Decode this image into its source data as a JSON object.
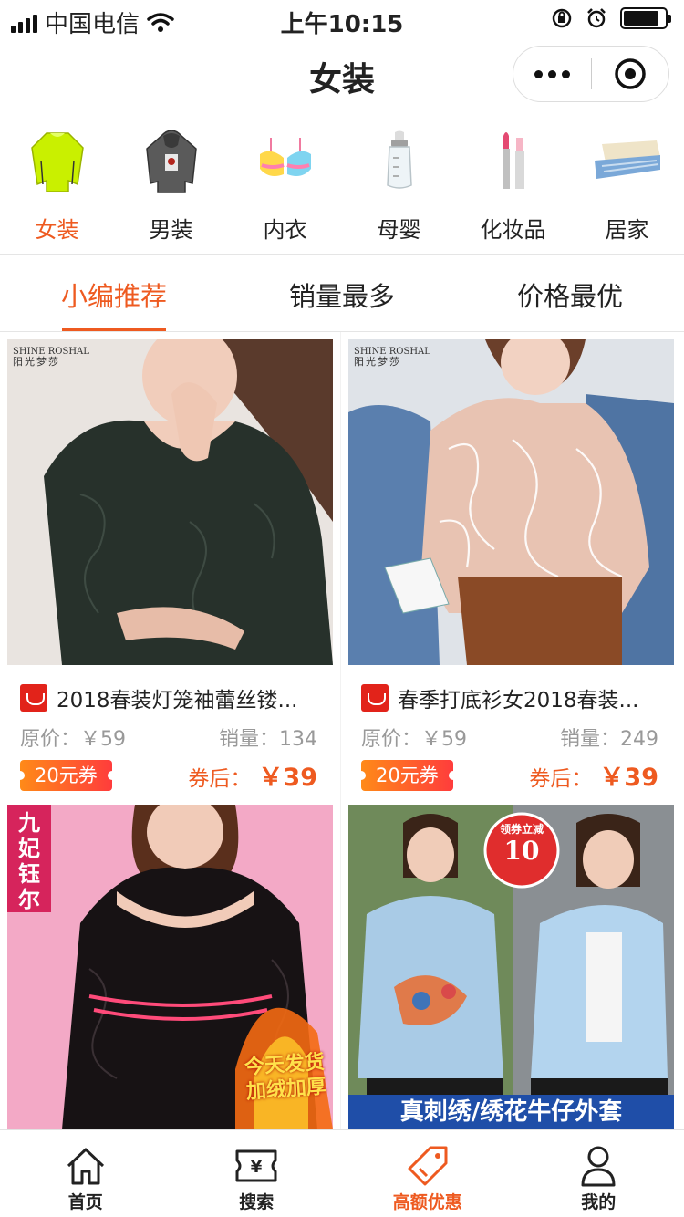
{
  "status": {
    "carrier": "中国电信",
    "time": "上午10:15"
  },
  "nav": {
    "title": "女装"
  },
  "categories": [
    {
      "label": "女装",
      "icon": "sweater-icon"
    },
    {
      "label": "男装",
      "icon": "hoodie-icon"
    },
    {
      "label": "内衣",
      "icon": "bra-icon"
    },
    {
      "label": "母婴",
      "icon": "baby-bottle-icon"
    },
    {
      "label": "化妆品",
      "icon": "lipstick-icon"
    },
    {
      "label": "居家",
      "icon": "bed-icon"
    }
  ],
  "tabs": [
    {
      "label": "小编推荐"
    },
    {
      "label": "销量最多"
    },
    {
      "label": "价格最优"
    }
  ],
  "products": [
    {
      "title": "2018春装灯笼袖蕾丝镂...",
      "original_label": "原价：",
      "original_price": "￥59",
      "sales_label": "销量：",
      "sales": "134",
      "coupon": "20元券",
      "after_label": "券后：",
      "after_price": "￥39",
      "brand_en": "SHINE ROSHAL",
      "brand_cn": "阳光梦莎"
    },
    {
      "title": "春季打底衫女2018春装...",
      "original_label": "原价：",
      "original_price": "￥59",
      "sales_label": "销量：",
      "sales": "249",
      "coupon": "20元券",
      "after_label": "券后：",
      "after_price": "￥39",
      "brand_en": "SHINE ROSHAL",
      "brand_cn": "阳光梦莎"
    },
    {
      "brand_cn": "九妃钰尔",
      "promo_line1": "今天发货",
      "promo_line2": "加绒加厚"
    },
    {
      "badge_top": "领券立减",
      "badge_num": "10",
      "banner": "真刺绣/绣花牛仔外套"
    }
  ],
  "tabbar": [
    {
      "label": "首页",
      "icon": "home-icon"
    },
    {
      "label": "搜索",
      "icon": "ticket-icon"
    },
    {
      "label": "高额优惠",
      "icon": "price-tag-icon"
    },
    {
      "label": "我的",
      "icon": "user-icon"
    }
  ],
  "colors": {
    "accent": "#ee5a20",
    "tmall_red": "#e2231a"
  }
}
